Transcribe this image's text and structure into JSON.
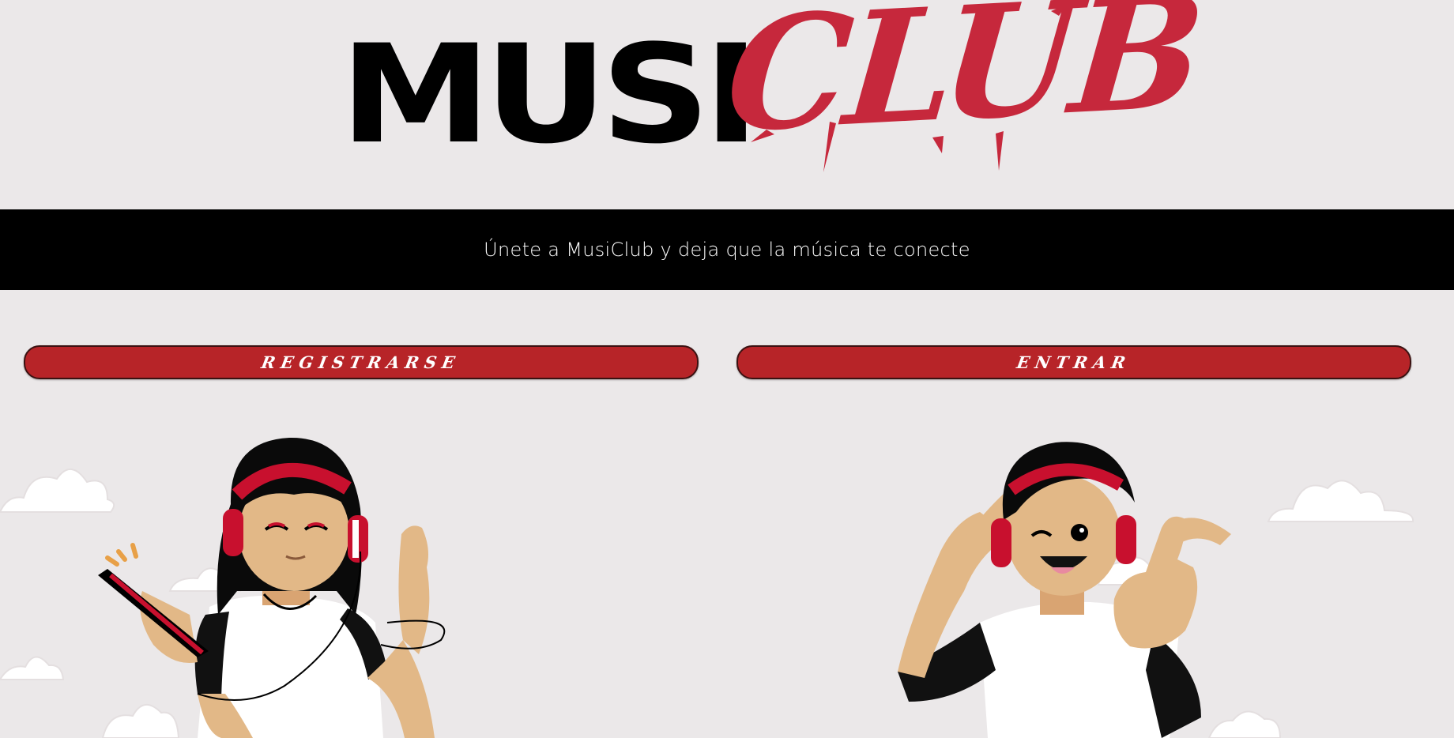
{
  "header": {
    "logo_part1": "MUSI",
    "logo_part2": "CLUB"
  },
  "banner": {
    "tagline": "Únete a MusiClub y deja que la música te conecte"
  },
  "actions": {
    "register_label": "REGISTRARSE",
    "enter_label": "ENTRAR"
  },
  "colors": {
    "background": "#ebe8e9",
    "banner": "#000000",
    "button": "#b72428",
    "accent": "#c6283c"
  },
  "illustrations": {
    "left": "girl-with-headphones-and-phone",
    "right": "boy-with-headphones-thumbs-up"
  }
}
